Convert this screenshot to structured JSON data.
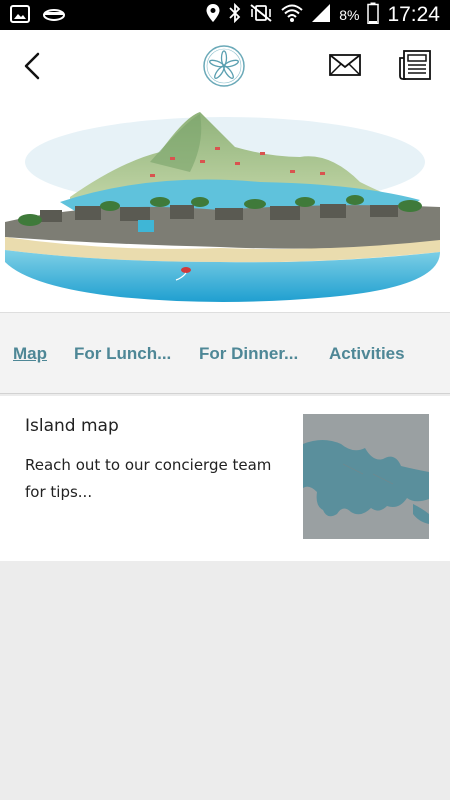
{
  "status_bar": {
    "battery_percent": "8%",
    "time": "17:24",
    "icons": [
      "gallery-icon",
      "cloud-icon",
      "location-icon",
      "bluetooth-icon",
      "vibrate-mute-icon",
      "wifi-icon",
      "signal-icon",
      "battery-icon"
    ]
  },
  "header": {
    "back_icon": "chevron-left-icon",
    "logo": "sand-dollar-logo",
    "mail_icon": "envelope-icon",
    "news_icon": "newspaper-icon"
  },
  "tabs": [
    {
      "label": "Map",
      "active": true
    },
    {
      "label": "For Lunch...",
      "active": false
    },
    {
      "label": "For Dinner...",
      "active": false
    },
    {
      "label": "Activities",
      "active": false
    }
  ],
  "card": {
    "title": "Island map",
    "description": "Reach out to our concierge team for tips..."
  },
  "colors": {
    "accent": "#4e8796",
    "tab_bar_bg": "#f3f3f3",
    "page_bg": "#ececec",
    "map_water": "#9aa0a2",
    "map_land": "#5a8f9c"
  }
}
